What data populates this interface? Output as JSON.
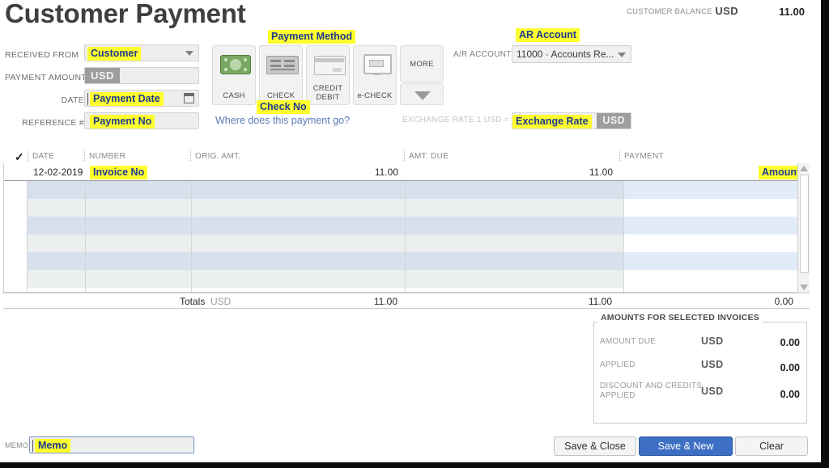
{
  "window": {
    "title": "Customer Payment"
  },
  "header": {
    "customer_balance_label": "CUSTOMER BALANCE",
    "customer_balance_currency": "USD",
    "customer_balance_amount": "11.00",
    "ar_account_label": "A/R ACCOUNT",
    "ar_account_value": "11000 · Accounts Re...",
    "ar_account_annotation": "AR Account",
    "exchange_rate_label": "EXCHANGE RATE 1 USD =",
    "exchange_rate_annotation": "Exchange Rate",
    "exchange_rate_currency": "USD"
  },
  "form": {
    "received_from_label": "RECEIVED FROM",
    "received_from_annotation": "Customer",
    "payment_amount_label": "PAYMENT AMOUNT",
    "payment_amount_currency": "USD",
    "date_label": "DATE",
    "date_annotation": "Payment Date",
    "reference_label": "REFERENCE #",
    "reference_annotation": "Payment No"
  },
  "payment_methods": {
    "annotation": "Payment Method",
    "check_annotation": "Check No",
    "tiles": [
      {
        "label": "CASH",
        "icon": "cash-icon"
      },
      {
        "label": "CHECK",
        "icon": "check-icon"
      },
      {
        "label": "CREDIT DEBIT",
        "line1": "CREDIT",
        "line2": "DEBIT",
        "icon": "credit-card-icon"
      },
      {
        "label": "e-CHECK",
        "icon": "echeck-monitor-icon"
      }
    ],
    "more_label": "MORE",
    "where_link": "Where does this payment go?"
  },
  "grid": {
    "columns": [
      "DATE",
      "NUMBER",
      "ORIG. AMT.",
      "AMT. DUE",
      "PAYMENT"
    ],
    "rows": [
      {
        "date": "12-02-2019",
        "number_annotation": "Invoice No",
        "orig_amt": "11.00",
        "amt_due": "11.00",
        "payment_annotation": "Amount"
      }
    ],
    "totals_label": "Totals",
    "totals_currency": "USD",
    "totals_orig_amt": "11.00",
    "totals_amt_due": "11.00",
    "totals_payment": "0.00"
  },
  "amounts_panel": {
    "title": "AMOUNTS FOR SELECTED INVOICES",
    "rows": [
      {
        "label": "AMOUNT DUE",
        "currency": "USD",
        "value": "0.00"
      },
      {
        "label": "APPLIED",
        "currency": "USD",
        "value": "0.00"
      },
      {
        "label_line1": "DISCOUNT AND CREDITS",
        "label_line2": "APPLIED",
        "currency": "USD",
        "value": "0.00"
      }
    ]
  },
  "memo": {
    "label": "MEMO",
    "annotation": "Memo"
  },
  "buttons": {
    "save_close": "Save & Close",
    "save_new": "Save & New",
    "clear": "Clear"
  },
  "colors": {
    "highlight": "#ffff2e",
    "annotation_text": "#1f3b8f",
    "primary_button": "#3d6fc4",
    "link": "#5a7ab5",
    "row_blue": "#d7e0ed",
    "row_gray": "#eceff0"
  }
}
